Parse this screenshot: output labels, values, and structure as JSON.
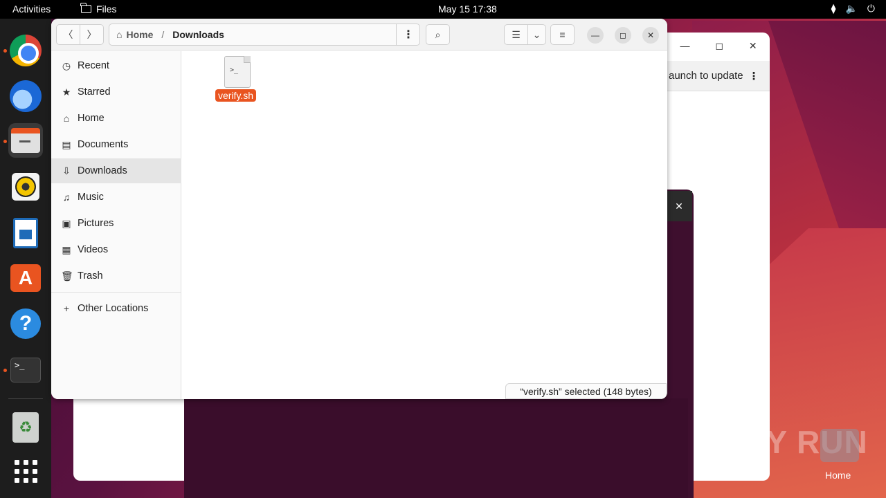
{
  "topbar": {
    "activities": "Activities",
    "app_name": "Files",
    "clock": "May 15  17:38"
  },
  "dock": {
    "items": [
      {
        "name": "chrome-icon"
      },
      {
        "name": "thunderbird-icon"
      },
      {
        "name": "files-icon"
      },
      {
        "name": "rhythmbox-icon"
      },
      {
        "name": "libreoffice-writer-icon"
      },
      {
        "name": "app-center-icon"
      },
      {
        "name": "help-icon"
      },
      {
        "name": "terminal-icon"
      },
      {
        "name": "trash-icon"
      },
      {
        "name": "show-apps-icon"
      }
    ]
  },
  "background_window": {
    "update_text": "aunch to update"
  },
  "files": {
    "path": {
      "home": "Home",
      "current": "Downloads"
    },
    "sidebar": [
      {
        "label": "Recent",
        "icon": "clock-icon"
      },
      {
        "label": "Starred",
        "icon": "star-icon"
      },
      {
        "label": "Home",
        "icon": "home-icon"
      },
      {
        "label": "Documents",
        "icon": "document-icon"
      },
      {
        "label": "Downloads",
        "icon": "download-icon"
      },
      {
        "label": "Music",
        "icon": "music-icon"
      },
      {
        "label": "Pictures",
        "icon": "picture-icon"
      },
      {
        "label": "Videos",
        "icon": "video-icon"
      },
      {
        "label": "Trash",
        "icon": "trash-icon"
      },
      {
        "label": "Other Locations",
        "icon": "plus-icon"
      }
    ],
    "selected_sidebar": "Downloads",
    "file": {
      "name": "verify.sh",
      "icon_text": ">_"
    },
    "status": "“verify.sh” selected  (148 bytes)"
  },
  "watermark": {
    "text": "ANY RUN",
    "home_label": "Home"
  },
  "colors": {
    "accent": "#e95420",
    "dock_bg": "#1d1d1d"
  }
}
